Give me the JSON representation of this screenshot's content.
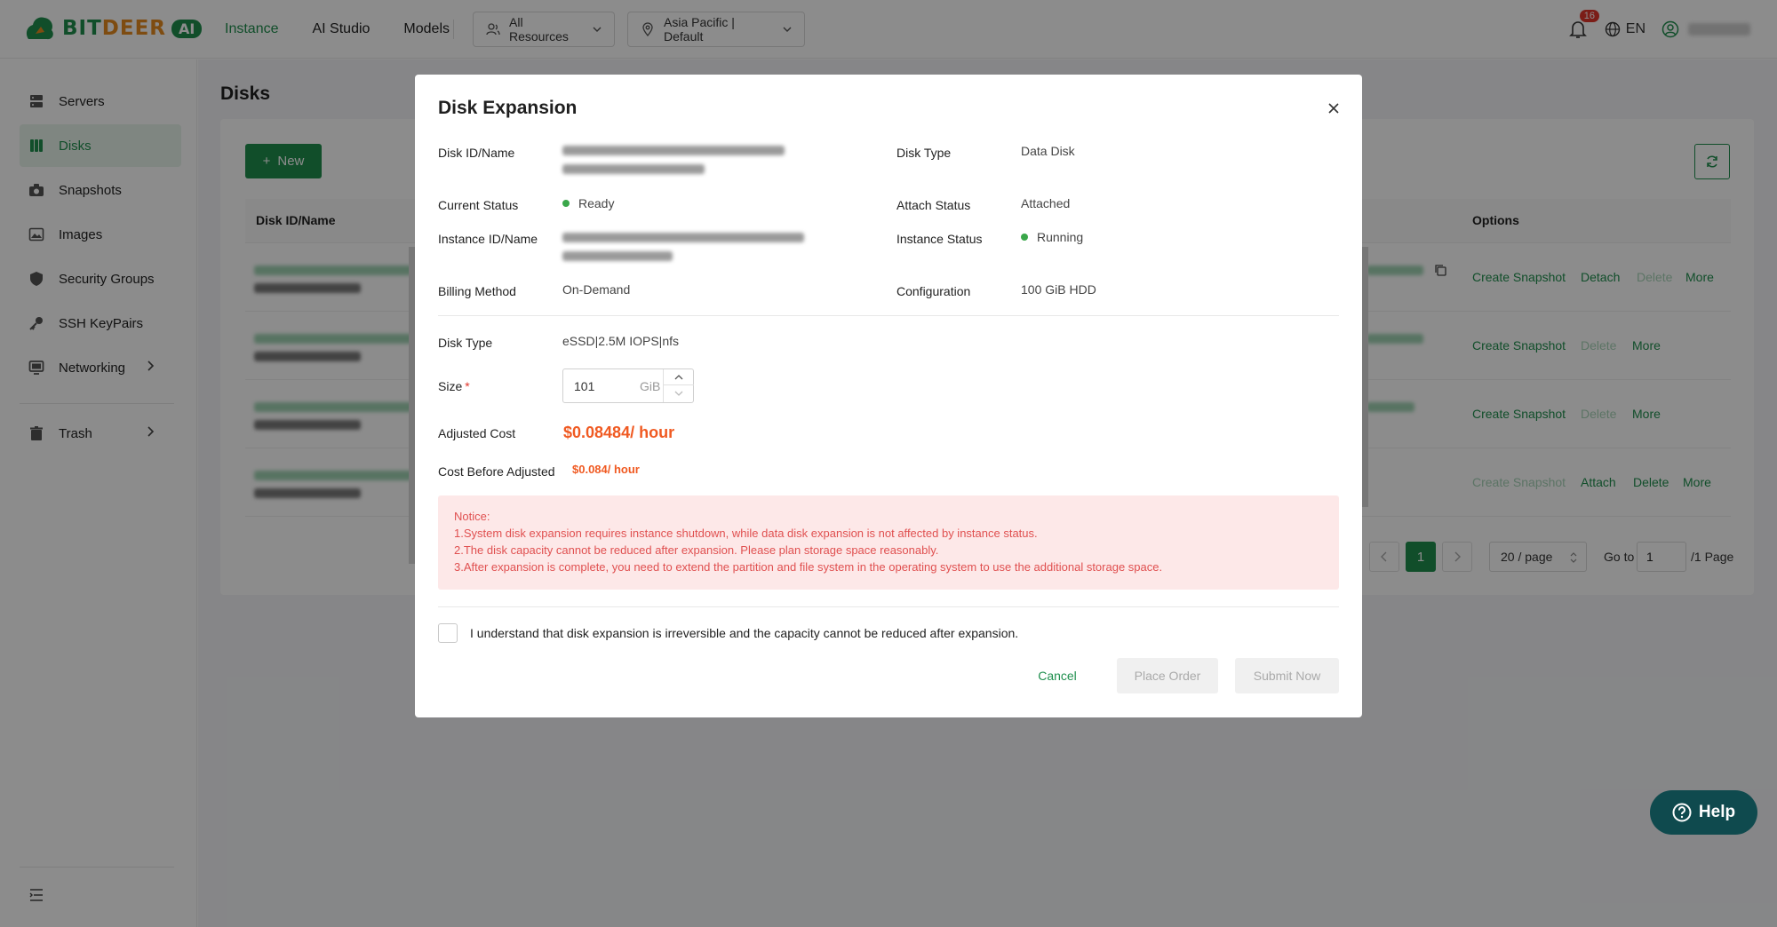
{
  "brand": {
    "name_part1": "BIT",
    "name_part2": "DEER",
    "ai_badge": "AI",
    "primary_color": "#1f8f4e",
    "accent_color": "#e58a1f"
  },
  "topnav": {
    "items": [
      {
        "label": "Instance",
        "active": true
      },
      {
        "label": "AI Studio",
        "active": false
      },
      {
        "label": "Models",
        "active": false
      }
    ],
    "resource_select": "All Resources",
    "region_select": "Asia Pacific | Default",
    "notification_count": "16",
    "language": "EN"
  },
  "sidebar": {
    "items": [
      {
        "label": "Servers",
        "icon": "server-icon"
      },
      {
        "label": "Disks",
        "icon": "disk-icon",
        "active": true
      },
      {
        "label": "Snapshots",
        "icon": "camera-icon"
      },
      {
        "label": "Images",
        "icon": "image-icon"
      },
      {
        "label": "Security Groups",
        "icon": "shield-icon"
      },
      {
        "label": "SSH KeyPairs",
        "icon": "key-icon"
      },
      {
        "label": "Networking",
        "icon": "monitor-icon"
      },
      {
        "label": "Trash",
        "icon": "trash-icon"
      }
    ]
  },
  "page": {
    "title": "Disks",
    "new_button": "New",
    "columns": {
      "disk": "Disk ID/Name",
      "options": "Options"
    },
    "rows": [
      {
        "options": [
          {
            "label": "Create Snapshot",
            "enabled": true
          },
          {
            "label": "Detach",
            "enabled": true
          },
          {
            "label": "Delete",
            "enabled": false
          },
          {
            "label": "More",
            "enabled": true
          }
        ]
      },
      {
        "options": [
          {
            "label": "Create Snapshot",
            "enabled": true
          },
          {
            "label": "Delete",
            "enabled": false
          },
          {
            "label": "More",
            "enabled": true
          }
        ]
      },
      {
        "options": [
          {
            "label": "Create Snapshot",
            "enabled": true
          },
          {
            "label": "Delete",
            "enabled": false
          },
          {
            "label": "More",
            "enabled": true
          }
        ]
      },
      {
        "options": [
          {
            "label": "Create Snapshot",
            "enabled": false
          },
          {
            "label": "Attach",
            "enabled": true
          },
          {
            "label": "Delete",
            "enabled": true
          },
          {
            "label": "More",
            "enabled": true
          }
        ]
      }
    ],
    "pagination": {
      "current_page": "1",
      "page_size": "20 / page",
      "goto_label": "Go to",
      "goto_value": "1",
      "total_suffix": "/1 Page"
    }
  },
  "modal": {
    "title": "Disk Expansion",
    "fields": {
      "disk_id_label": "Disk ID/Name",
      "disk_type_label": "Disk Type",
      "disk_type_value": "Data Disk",
      "current_status_label": "Current Status",
      "current_status_value": "Ready",
      "attach_status_label": "Attach Status",
      "attach_status_value": "Attached",
      "instance_id_label": "Instance ID/Name",
      "instance_status_label": "Instance Status",
      "instance_status_value": "Running",
      "billing_label": "Billing Method",
      "billing_value": "On-Demand",
      "config_label": "Configuration",
      "config_value": "100 GiB HDD"
    },
    "form": {
      "disk_type_label": "Disk Type",
      "disk_type_value": "eSSD|2.5M IOPS|nfs",
      "size_label": "Size",
      "size_required": "*",
      "size_value": "101",
      "size_unit": "GiB",
      "adjusted_cost_label": "Adjusted Cost",
      "adjusted_cost_value": "$0.08484/ hour",
      "cost_before_label": "Cost Before Adjusted",
      "cost_before_value": "$0.084/ hour"
    },
    "notice": {
      "title": "Notice:",
      "lines": [
        "1.System disk expansion requires instance shutdown, while data disk expansion is not affected by instance status.",
        "2.The disk capacity cannot be reduced after expansion. Please plan storage space reasonably.",
        "3.After expansion is complete, you need to extend the partition and file system in the operating system to use the additional storage space."
      ]
    },
    "agreement": "I understand that disk expansion is irreversible and the capacity cannot be reduced after expansion.",
    "buttons": {
      "cancel": "Cancel",
      "place_order": "Place Order",
      "submit": "Submit Now"
    },
    "status_color": "#3aa74a",
    "price_color": "#f05a22"
  },
  "help": {
    "label": "Help"
  }
}
